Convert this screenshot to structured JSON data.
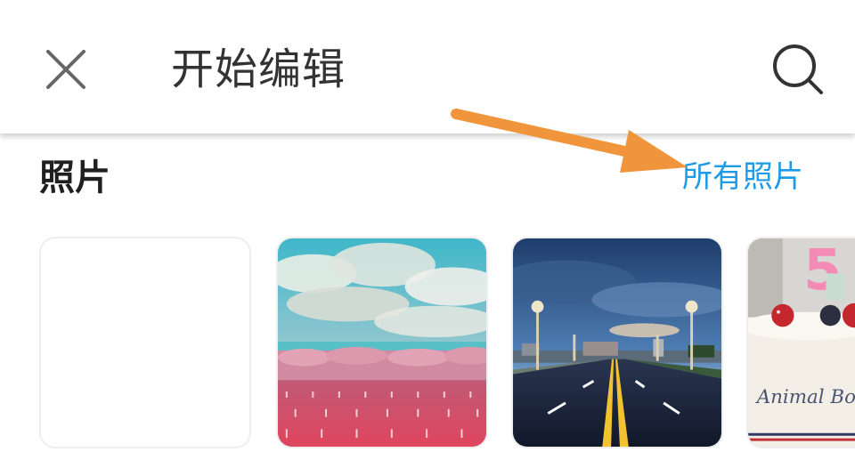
{
  "header": {
    "title": "开始编辑",
    "close_icon": "close-icon",
    "search_icon": "search-icon"
  },
  "photos_section": {
    "title": "照片",
    "all_photos_label": "所有照片",
    "all_photos_color": "#1e9be6",
    "annotation_arrow_color": "#f0953c",
    "thumbnails": [
      {
        "kind": "empty"
      },
      {
        "kind": "pink-flower-field-under-cloudy-sky"
      },
      {
        "kind": "road-with-streetlights-under-blue-sky"
      },
      {
        "kind": "cake-with-strawberries-and-candle"
      }
    ],
    "cake_candle_number": "5",
    "cake_text": "Animal Bow"
  }
}
